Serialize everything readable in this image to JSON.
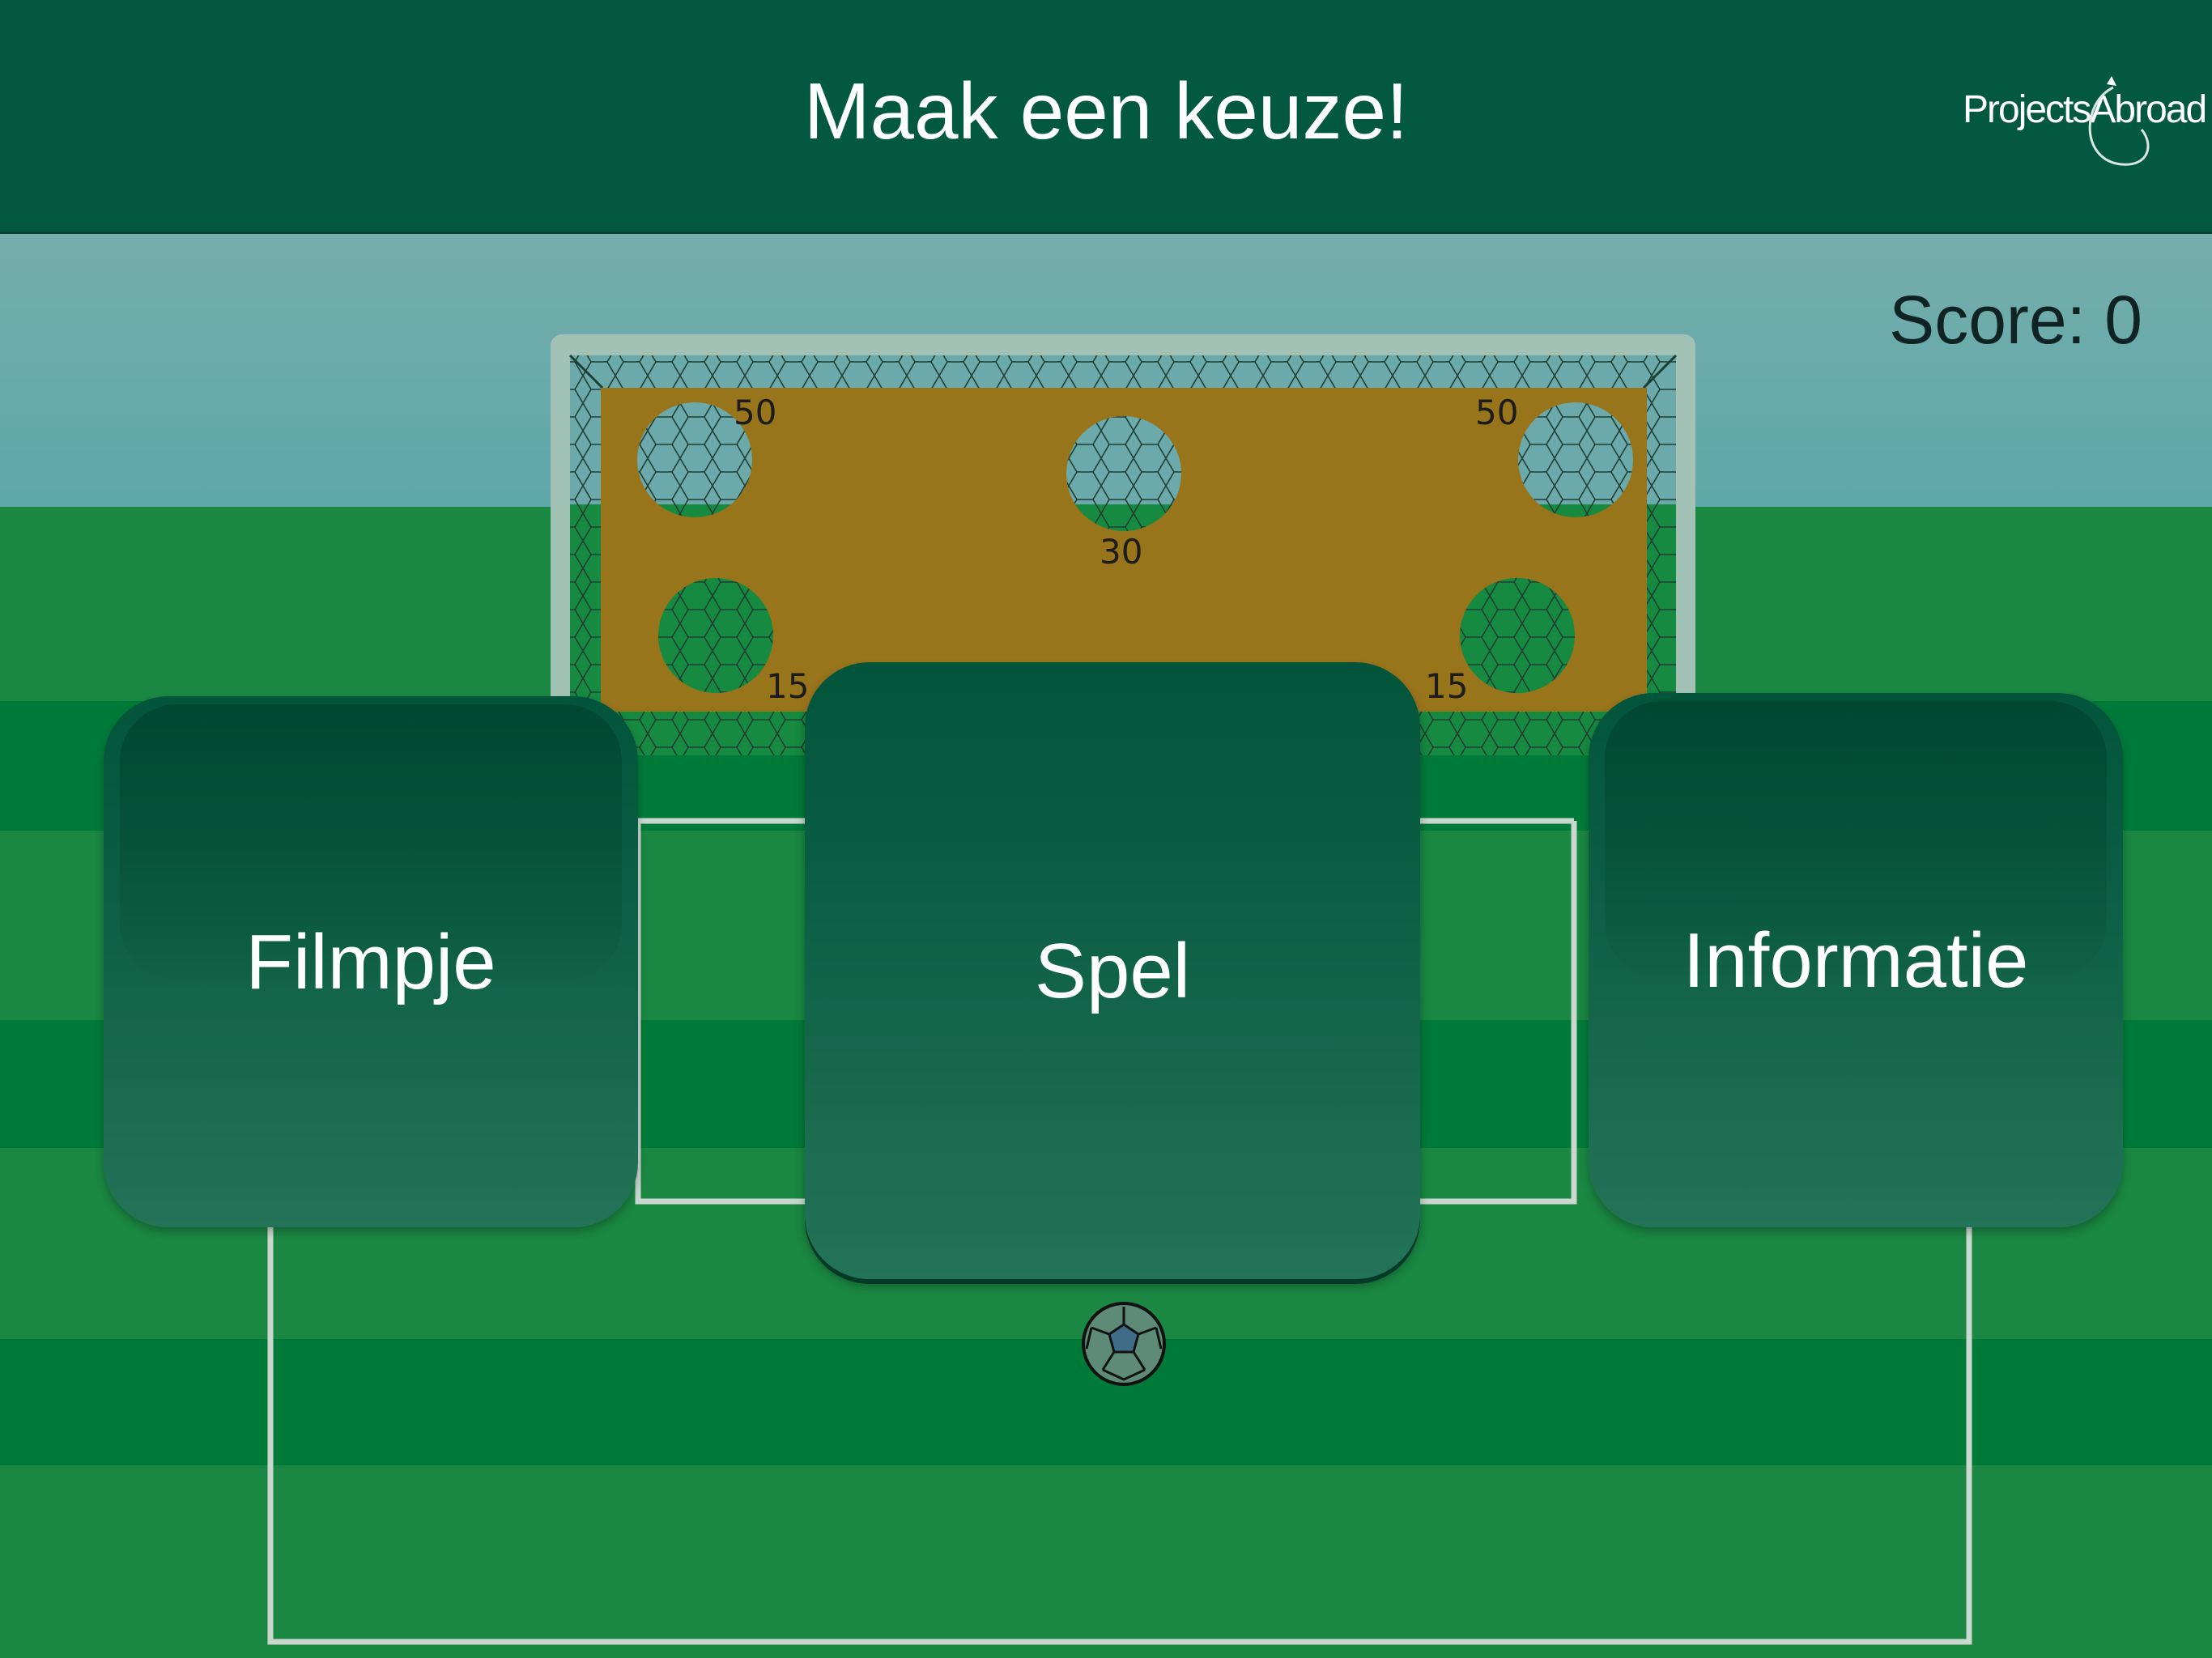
{
  "header": {
    "title": "Maak een keuze!",
    "logo_text": "ProjectsAbroad"
  },
  "game": {
    "score_text": "Score: 0",
    "targets": [
      {
        "points": "50"
      },
      {
        "points": "30"
      },
      {
        "points": "50"
      },
      {
        "points": "15"
      },
      {
        "points": "15"
      }
    ]
  },
  "menu": {
    "buttons": [
      {
        "label": "Filmpje"
      },
      {
        "label": "Spel"
      },
      {
        "label": "Informatie"
      }
    ]
  },
  "colors": {
    "header_bg": "#02593f",
    "sky": "#6aabab",
    "grass_light": "#1a8742",
    "grass_dark": "#007a38",
    "goal_board": "#98741b",
    "card_top": "#02553b",
    "card_bottom": "#237358"
  },
  "icons": [
    "soccer-ball-icon",
    "projects-abroad-logo"
  ]
}
